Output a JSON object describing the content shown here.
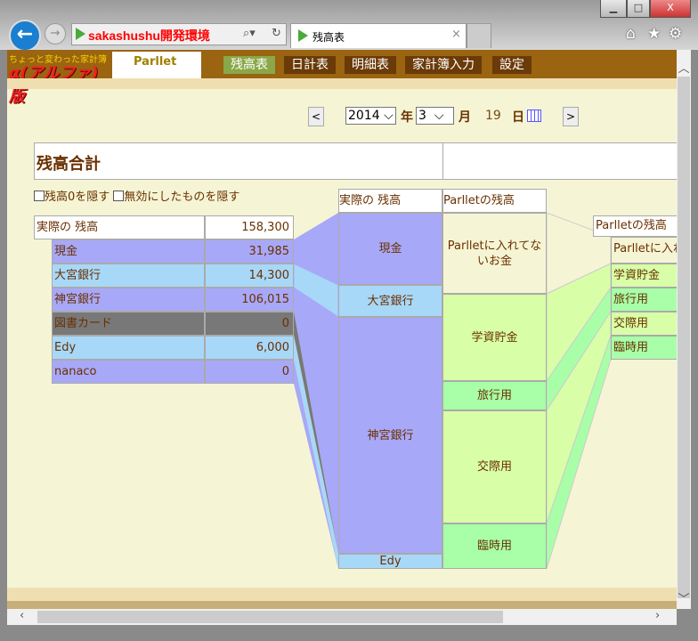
{
  "browser": {
    "address": "sakashushu開発環境",
    "tab_title": "残高表",
    "close": "×",
    "back": "←",
    "forward": "→",
    "min": "▁",
    "max": "□",
    "close_window": "X",
    "home": "⌂",
    "star": "★",
    "gear": "⚙"
  },
  "site": {
    "logo_small": "ちょっと変わった家計簿",
    "logo_big": "α(アルファ)版",
    "logo2": "Parllet",
    "nav": [
      {
        "label": "残高表",
        "active": true
      },
      {
        "label": "日計表"
      },
      {
        "label": "明細表"
      },
      {
        "label": "家計簿入力"
      },
      {
        "label": "設定"
      }
    ]
  },
  "date": {
    "prev": "<",
    "next": ">",
    "year": "2014",
    "year_label": "年",
    "month": "3",
    "month_label": "月",
    "day": "19",
    "day_label": "日"
  },
  "title": "残高合計",
  "filters": [
    {
      "label": "残高0を隠す",
      "checked": false
    },
    {
      "label": "無効にしたものを隠す",
      "checked": false
    }
  ],
  "balance_table": {
    "header": {
      "name": "実際の 残高",
      "value": "158,300"
    },
    "rows": [
      {
        "name": "現金",
        "value": "31,985"
      },
      {
        "name": "大宮銀行",
        "value": "14,300"
      },
      {
        "name": "神宮銀行",
        "value": "106,015"
      },
      {
        "name": "図書カード",
        "value": "0"
      },
      {
        "name": "Edy",
        "value": "6,000"
      },
      {
        "name": "nanaco",
        "value": "0"
      }
    ]
  },
  "sankey": {
    "col1_header": "実際の 残高",
    "col1": [
      "現金",
      "大宮銀行",
      "神宮銀行",
      "Edy"
    ],
    "col2_header": "Parlletの残高",
    "col2": [
      "Parlletに入れてないお金",
      "学資貯金",
      "旅行用",
      "交際用",
      "臨時用"
    ]
  },
  "parllet_table": {
    "header": "Parlletの残高",
    "rows": [
      "Parlletに入れてないお金",
      "学資貯金",
      "旅行用",
      "交際用",
      "臨時用"
    ]
  }
}
